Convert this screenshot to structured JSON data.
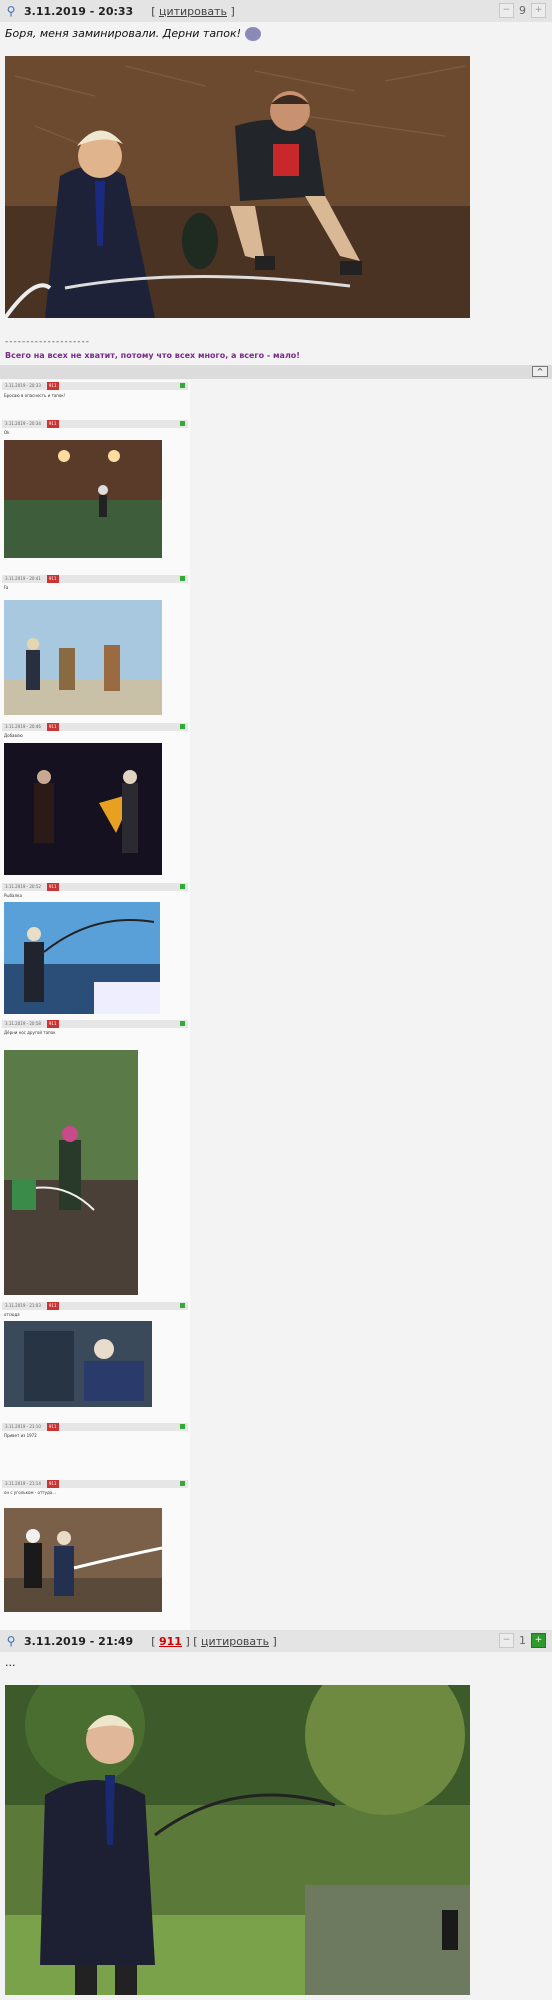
{
  "post1": {
    "date": "3.11.2019 - 20:33",
    "quote_label": "цитировать",
    "text": "Боря, меня заминировали. Дерни тапок!",
    "vote_count": "9",
    "sig_dashes": "--------------------",
    "signature": "Всего на всех не хватит, потому что всех много, а всего - мало!"
  },
  "separator": {
    "up_label": "^"
  },
  "thread": {
    "items": [
      {
        "bar": "3.11.2019 - 20:33",
        "text": "Бросаю в опасность и тапок!"
      },
      {
        "bar": "3.11.2019 - 20:34",
        "text": "Ok"
      },
      {
        "bar": "3.11.2019 - 20:41",
        "text": "Fa"
      },
      {
        "bar": "3.11.2019 - 20:46",
        "text": "Добавлю"
      },
      {
        "bar": "3.11.2019 - 20:52",
        "text": "Рыбалка"
      },
      {
        "bar": "3.11.2019 - 20:58",
        "text": "Дёрни нос другой тапок"
      },
      {
        "bar": "3.11.2019 - 21:03",
        "text": "отсюда"
      },
      {
        "bar": "3.11.2019 - 21:10",
        "text": "Привет из 1972"
      },
      {
        "bar": "3.11.2019 - 21:14",
        "text": "он с угольком - оттуда..."
      }
    ]
  },
  "post2": {
    "date": "3.11.2019 - 21:49",
    "reply_num": "911",
    "quote_label": "цитировать",
    "text": "...",
    "vote_count": "1"
  },
  "icons": {
    "pin": "pin-icon",
    "minus": "minus-icon",
    "plus": "plus-icon",
    "smile": "smile-icon"
  }
}
